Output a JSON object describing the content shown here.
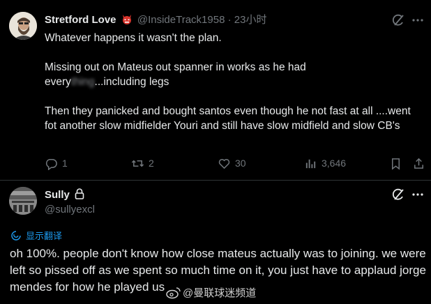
{
  "tweet1": {
    "name": "Stretford Love",
    "handle": "@InsideTrack1958",
    "separator": " · ",
    "time": "23小时",
    "lines": {
      "l1": "Whatever happens it wasn't the plan.",
      "l2": "Missing out on Mateus out spanner in works as he had",
      "l3a": "every",
      "l3b": "thing",
      "l3c": "...including legs",
      "l4": "Then they panicked and bought santos even though he not fast at all ....went fot another slow midfielder Youri and still have slow midfield and slow CB's"
    },
    "replies": "1",
    "retweets": "2",
    "likes": "30",
    "views": "3,646",
    "badge_icon": "devil-face-icon"
  },
  "tweet2": {
    "name": "Sully",
    "handle": "@sullyexcl",
    "translate_label": "显示翻译",
    "text": "oh 100%. people don't know how close mateus actually was to joining. we were left so pissed off as we spent so much time on it, you just have to applaud jorge mendes for how he played us",
    "lock_icon": "lock-icon"
  },
  "watermark": {
    "text": "@曼联球迷频道"
  },
  "colors": {
    "background": "#000000",
    "text": "#e7e9ea",
    "muted": "#71767b",
    "accent": "#1d9bf0",
    "divider": "#2f3336"
  }
}
